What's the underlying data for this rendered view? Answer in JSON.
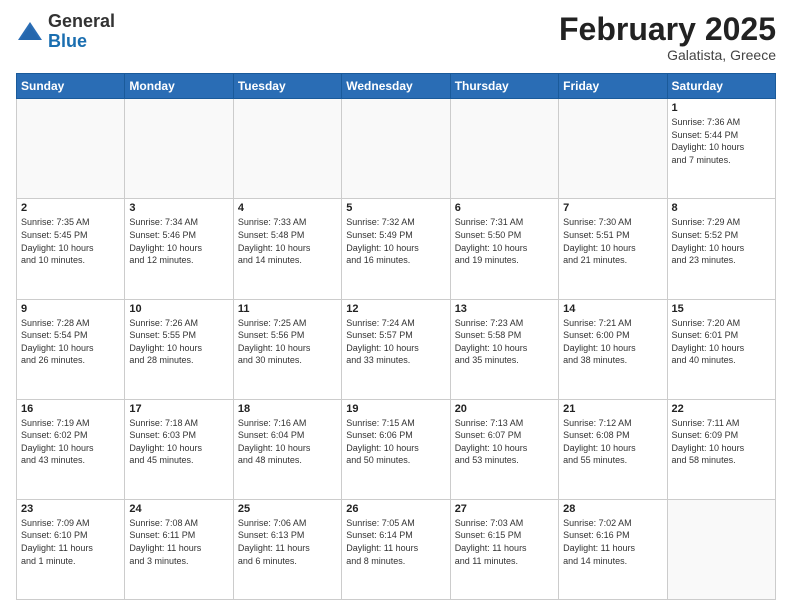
{
  "logo": {
    "general": "General",
    "blue": "Blue"
  },
  "header": {
    "month": "February 2025",
    "location": "Galatista, Greece"
  },
  "weekdays": [
    "Sunday",
    "Monday",
    "Tuesday",
    "Wednesday",
    "Thursday",
    "Friday",
    "Saturday"
  ],
  "weeks": [
    [
      {
        "day": "",
        "info": ""
      },
      {
        "day": "",
        "info": ""
      },
      {
        "day": "",
        "info": ""
      },
      {
        "day": "",
        "info": ""
      },
      {
        "day": "",
        "info": ""
      },
      {
        "day": "",
        "info": ""
      },
      {
        "day": "1",
        "info": "Sunrise: 7:36 AM\nSunset: 5:44 PM\nDaylight: 10 hours\nand 7 minutes."
      }
    ],
    [
      {
        "day": "2",
        "info": "Sunrise: 7:35 AM\nSunset: 5:45 PM\nDaylight: 10 hours\nand 10 minutes."
      },
      {
        "day": "3",
        "info": "Sunrise: 7:34 AM\nSunset: 5:46 PM\nDaylight: 10 hours\nand 12 minutes."
      },
      {
        "day": "4",
        "info": "Sunrise: 7:33 AM\nSunset: 5:48 PM\nDaylight: 10 hours\nand 14 minutes."
      },
      {
        "day": "5",
        "info": "Sunrise: 7:32 AM\nSunset: 5:49 PM\nDaylight: 10 hours\nand 16 minutes."
      },
      {
        "day": "6",
        "info": "Sunrise: 7:31 AM\nSunset: 5:50 PM\nDaylight: 10 hours\nand 19 minutes."
      },
      {
        "day": "7",
        "info": "Sunrise: 7:30 AM\nSunset: 5:51 PM\nDaylight: 10 hours\nand 21 minutes."
      },
      {
        "day": "8",
        "info": "Sunrise: 7:29 AM\nSunset: 5:52 PM\nDaylight: 10 hours\nand 23 minutes."
      }
    ],
    [
      {
        "day": "9",
        "info": "Sunrise: 7:28 AM\nSunset: 5:54 PM\nDaylight: 10 hours\nand 26 minutes."
      },
      {
        "day": "10",
        "info": "Sunrise: 7:26 AM\nSunset: 5:55 PM\nDaylight: 10 hours\nand 28 minutes."
      },
      {
        "day": "11",
        "info": "Sunrise: 7:25 AM\nSunset: 5:56 PM\nDaylight: 10 hours\nand 30 minutes."
      },
      {
        "day": "12",
        "info": "Sunrise: 7:24 AM\nSunset: 5:57 PM\nDaylight: 10 hours\nand 33 minutes."
      },
      {
        "day": "13",
        "info": "Sunrise: 7:23 AM\nSunset: 5:58 PM\nDaylight: 10 hours\nand 35 minutes."
      },
      {
        "day": "14",
        "info": "Sunrise: 7:21 AM\nSunset: 6:00 PM\nDaylight: 10 hours\nand 38 minutes."
      },
      {
        "day": "15",
        "info": "Sunrise: 7:20 AM\nSunset: 6:01 PM\nDaylight: 10 hours\nand 40 minutes."
      }
    ],
    [
      {
        "day": "16",
        "info": "Sunrise: 7:19 AM\nSunset: 6:02 PM\nDaylight: 10 hours\nand 43 minutes."
      },
      {
        "day": "17",
        "info": "Sunrise: 7:18 AM\nSunset: 6:03 PM\nDaylight: 10 hours\nand 45 minutes."
      },
      {
        "day": "18",
        "info": "Sunrise: 7:16 AM\nSunset: 6:04 PM\nDaylight: 10 hours\nand 48 minutes."
      },
      {
        "day": "19",
        "info": "Sunrise: 7:15 AM\nSunset: 6:06 PM\nDaylight: 10 hours\nand 50 minutes."
      },
      {
        "day": "20",
        "info": "Sunrise: 7:13 AM\nSunset: 6:07 PM\nDaylight: 10 hours\nand 53 minutes."
      },
      {
        "day": "21",
        "info": "Sunrise: 7:12 AM\nSunset: 6:08 PM\nDaylight: 10 hours\nand 55 minutes."
      },
      {
        "day": "22",
        "info": "Sunrise: 7:11 AM\nSunset: 6:09 PM\nDaylight: 10 hours\nand 58 minutes."
      }
    ],
    [
      {
        "day": "23",
        "info": "Sunrise: 7:09 AM\nSunset: 6:10 PM\nDaylight: 11 hours\nand 1 minute."
      },
      {
        "day": "24",
        "info": "Sunrise: 7:08 AM\nSunset: 6:11 PM\nDaylight: 11 hours\nand 3 minutes."
      },
      {
        "day": "25",
        "info": "Sunrise: 7:06 AM\nSunset: 6:13 PM\nDaylight: 11 hours\nand 6 minutes."
      },
      {
        "day": "26",
        "info": "Sunrise: 7:05 AM\nSunset: 6:14 PM\nDaylight: 11 hours\nand 8 minutes."
      },
      {
        "day": "27",
        "info": "Sunrise: 7:03 AM\nSunset: 6:15 PM\nDaylight: 11 hours\nand 11 minutes."
      },
      {
        "day": "28",
        "info": "Sunrise: 7:02 AM\nSunset: 6:16 PM\nDaylight: 11 hours\nand 14 minutes."
      },
      {
        "day": "",
        "info": ""
      }
    ]
  ]
}
